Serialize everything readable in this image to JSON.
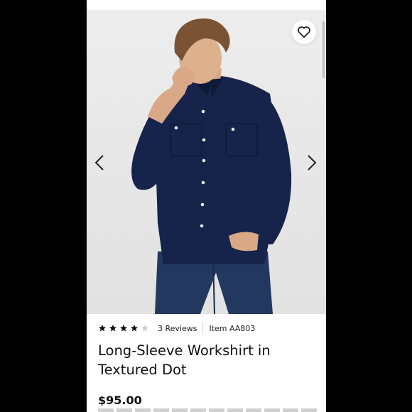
{
  "product": {
    "rating": 4,
    "rating_max": 5,
    "reviews_label": "3 Reviews",
    "item_label": "Item AA803",
    "title": "Long-Sleeve Workshirt in Textured Dot",
    "price": "$95.00"
  },
  "icons": {
    "favorite": "heart-icon",
    "prev": "chevron-left-icon",
    "next": "chevron-right-icon",
    "star": "star-icon"
  },
  "colors": {
    "star_filled": "#111111",
    "star_empty": "#d0d0d0",
    "shirt": "#16234a",
    "jeans": "#23385f"
  }
}
